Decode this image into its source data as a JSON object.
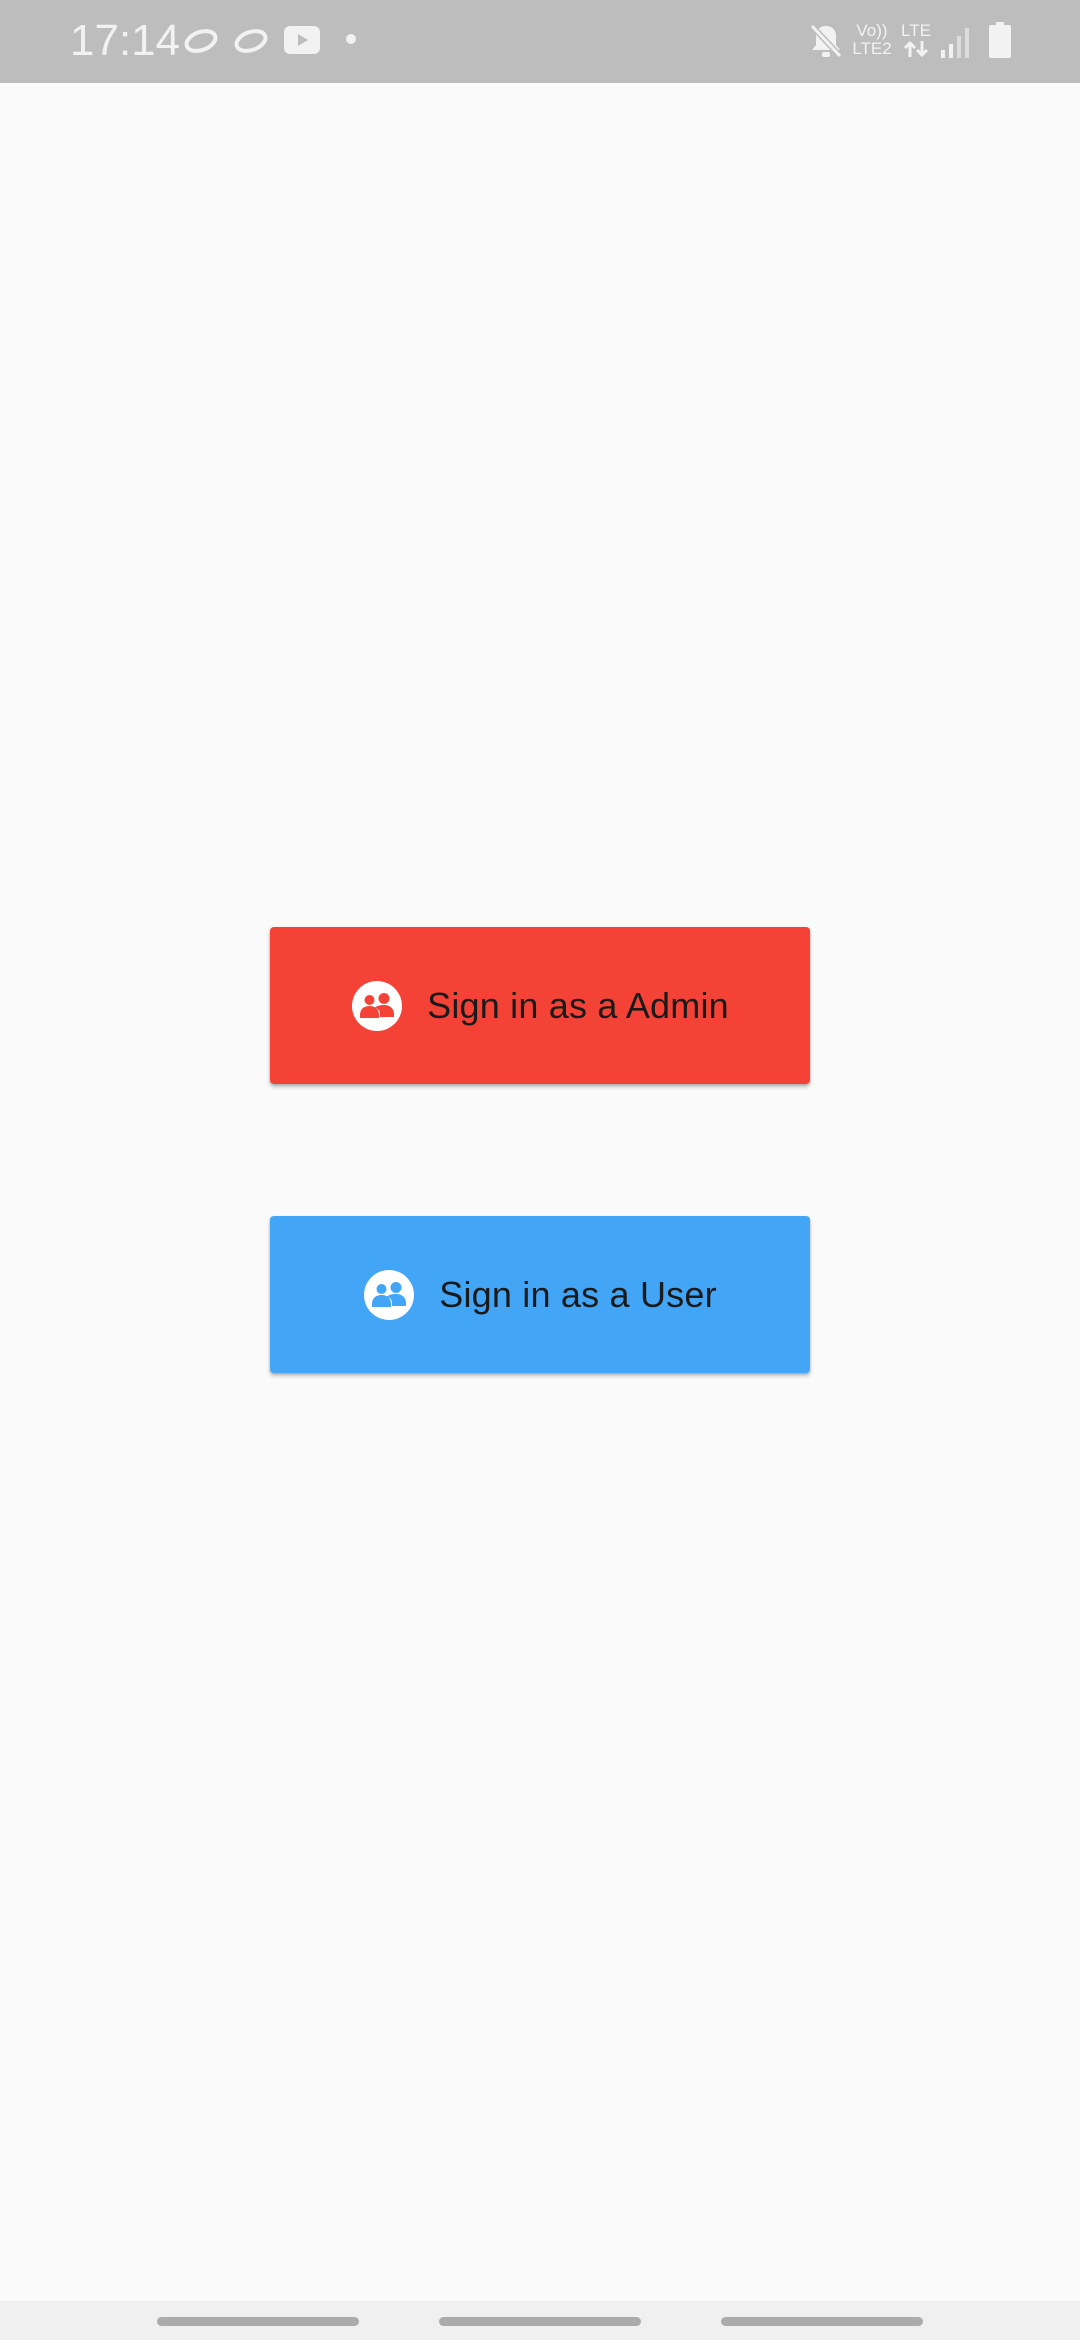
{
  "status_bar": {
    "time": "17:14",
    "network_top": "Vo))",
    "network_bottom": "LTE2",
    "lte_label": "LTE",
    "icons": [
      "link-icon",
      "link-icon",
      "youtube-icon",
      "dot-icon",
      "mute-icon",
      "data-arrows-icon",
      "signal-icon",
      "battery-icon"
    ]
  },
  "buttons": {
    "admin": {
      "label": "Sign in as a Admin",
      "color": "#F44336",
      "icon": "people-icon"
    },
    "user": {
      "label": "Sign in as a User",
      "color": "#42A5F5",
      "icon": "people-icon"
    }
  },
  "colors": {
    "background": "#FAFAFA",
    "status_bar": "#BDBDBD",
    "label_text": "#1A1A1A"
  }
}
